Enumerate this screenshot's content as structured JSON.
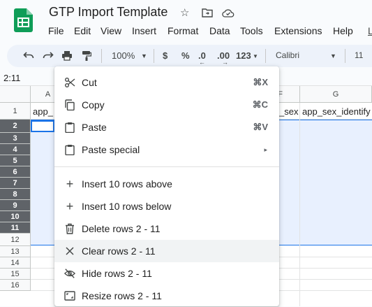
{
  "title_bar": {
    "doc_title": "GTP Import Template",
    "icons": [
      "star-icon",
      "move-to-folder-icon",
      "cloud-saved-icon"
    ]
  },
  "menu_bar": {
    "items": [
      "File",
      "Edit",
      "View",
      "Insert",
      "Format",
      "Data",
      "Tools",
      "Extensions",
      "Help",
      "L"
    ]
  },
  "toolbar": {
    "zoom": "100%",
    "currency": "$",
    "percent": "%",
    "decrease_decimal": ".0",
    "increase_decimal": ".00",
    "more_formats": "123",
    "font_name": "Calibri",
    "font_size": "11"
  },
  "formula_bar": {
    "name_box": "2:11"
  },
  "grid": {
    "columns": [
      "A",
      "F",
      "G"
    ],
    "header_cells": {
      "a1": "app_",
      "f1": "_sex",
      "g1": "app_sex_identify"
    },
    "rows": [
      "1",
      "2",
      "3",
      "4",
      "5",
      "6",
      "7",
      "8",
      "9",
      "10",
      "11",
      "12",
      "13",
      "14",
      "15",
      "16"
    ],
    "selected_rows": "2 - 11"
  },
  "context_menu": {
    "items": [
      {
        "label": "Cut",
        "shortcut": "⌘X",
        "icon": "scissors-icon"
      },
      {
        "label": "Copy",
        "shortcut": "⌘C",
        "icon": "copy-icon"
      },
      {
        "label": "Paste",
        "shortcut": "⌘V",
        "icon": "clipboard-icon"
      },
      {
        "label": "Paste special",
        "arrow": "▸",
        "icon": "clipboard-icon"
      },
      {
        "label": "Insert 10 rows above",
        "icon": "plus-icon"
      },
      {
        "label": "Insert 10 rows below",
        "icon": "plus-icon"
      },
      {
        "label": "Delete rows 2 - 11",
        "icon": "trash-icon"
      },
      {
        "label": "Clear rows 2 - 11",
        "icon": "close-icon"
      },
      {
        "label": "Hide rows 2 - 11",
        "icon": "eye-off-icon"
      },
      {
        "label": "Resize rows 2 - 11",
        "icon": "resize-icon"
      }
    ]
  },
  "colors": {
    "brand_green": "#0f9d58",
    "selection": "#e8f0fe",
    "accent_blue": "#1a73e8"
  }
}
